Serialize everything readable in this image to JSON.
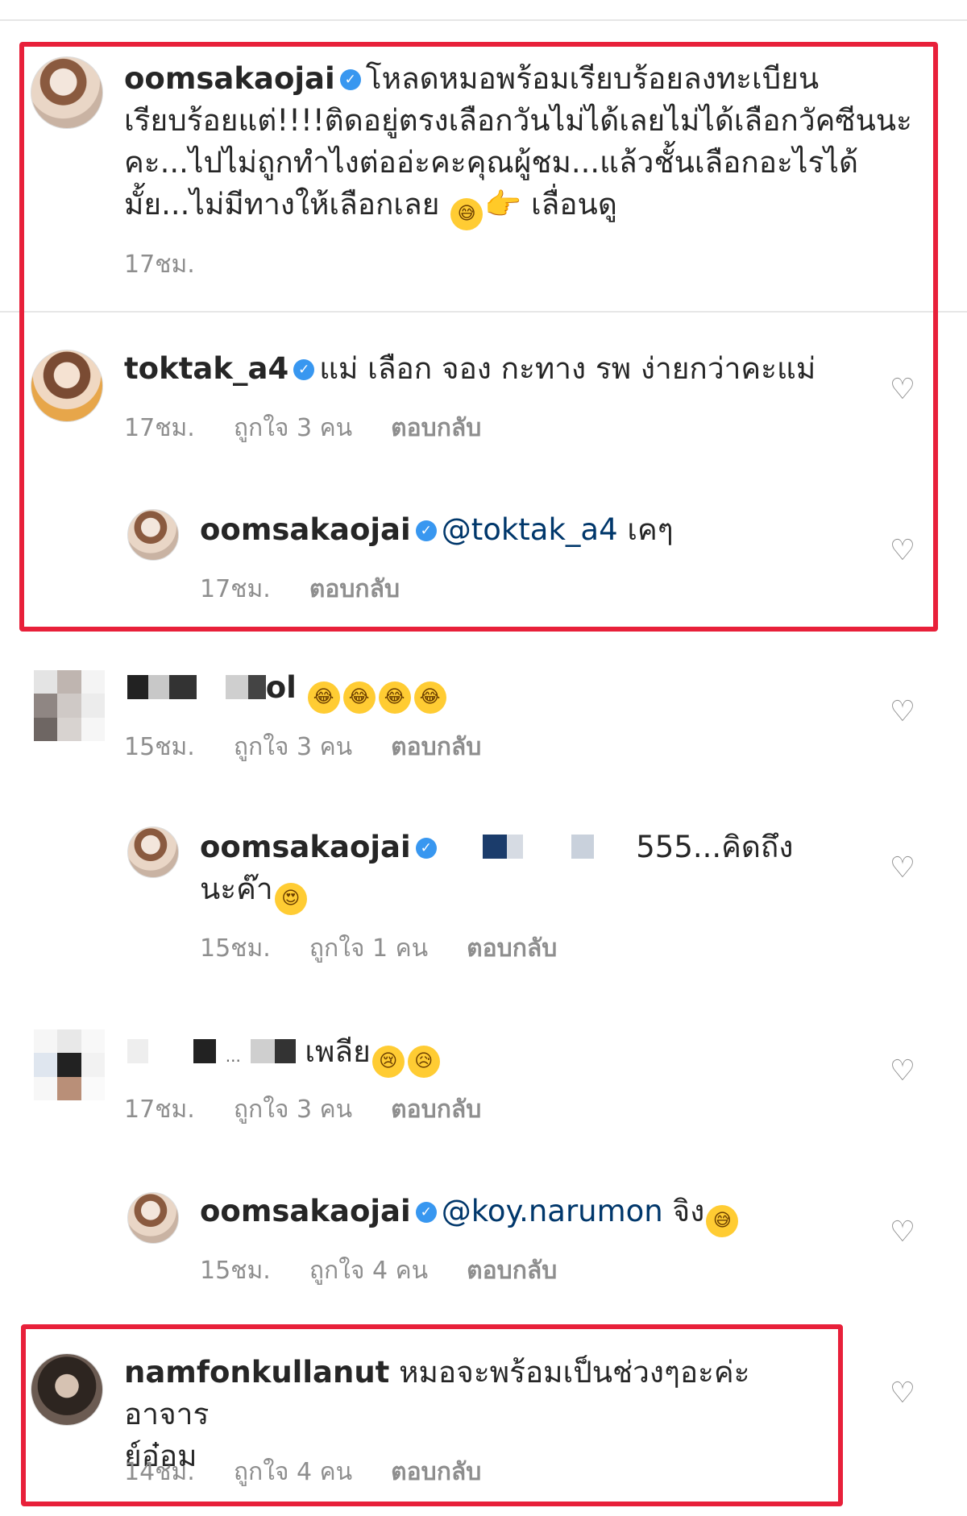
{
  "comments": [
    {
      "username": "oomsakaojai",
      "text": "โหลดหมอพร้อมเรียบร้อยลงทะเบียนเรียบร้อยแต่!!!!ติดอยู่ตรงเลือกวันไม่ได้เลยไม่ได้เลือกวัคซีนนะคะ...ไปไม่ถูกทำไงต่ออ่ะคะคุณผู้ชม...แล้วชั้นเลือกอะไรได้มั้ย...ไม่มีทางให้เลือกเลย",
      "emoji_a": "😅",
      "emoji_b": "👉",
      "text_tail": "เลื่อนดู",
      "time": "17ชม."
    },
    {
      "username": "toktak_a4",
      "text": "แม่ เลือก จอง กะทาง รพ ง่ายกว่าคะแม่",
      "time": "17ชม.",
      "likes": "ถูกใจ 3 คน",
      "reply": "ตอบกลับ"
    },
    {
      "username": "oomsakaojai",
      "mention": "@toktak_a4",
      "text": "เคๆ",
      "time": "17ชม.",
      "reply": "ตอบกลับ"
    },
    {
      "username_tail": "ol",
      "time": "15ชม.",
      "likes": "ถูกใจ 3 คน",
      "reply": "ตอบกลับ",
      "emoji": "😂"
    },
    {
      "username": "oomsakaojai",
      "text_a": "555...คิดถึง",
      "text_b": "นะค๊า",
      "emoji": "😍",
      "time": "15ชม.",
      "likes": "ถูกใจ 1 คน",
      "reply": "ตอบกลับ"
    },
    {
      "username_mid": "...",
      "text": "เพลีย",
      "emoji_a": "😢",
      "emoji_b": "😥",
      "time": "17ชม.",
      "likes": "ถูกใจ 3 คน",
      "reply": "ตอบกลับ"
    },
    {
      "username": "oomsakaojai",
      "mention": "@koy.narumon",
      "text": "จิง",
      "emoji": "😅",
      "time": "15ชม.",
      "likes": "ถูกใจ 4 คน",
      "reply": "ตอบกลับ"
    },
    {
      "username": "namfonkullanut",
      "text_a": "หมอจะพร้อมเป็นช่วงๆอะค่ะอาจาร",
      "text_b": "ย์อ๋อม",
      "time": "14ชม.",
      "likes": "ถูกใจ 4 คน",
      "reply": "ตอบกลับ"
    }
  ],
  "icons": {
    "verified": "verified-badge-icon",
    "heart": "heart-outline-icon"
  },
  "colors": {
    "highlight": "#e8203a",
    "verified": "#3897f0",
    "meta": "#8e8e8e"
  }
}
